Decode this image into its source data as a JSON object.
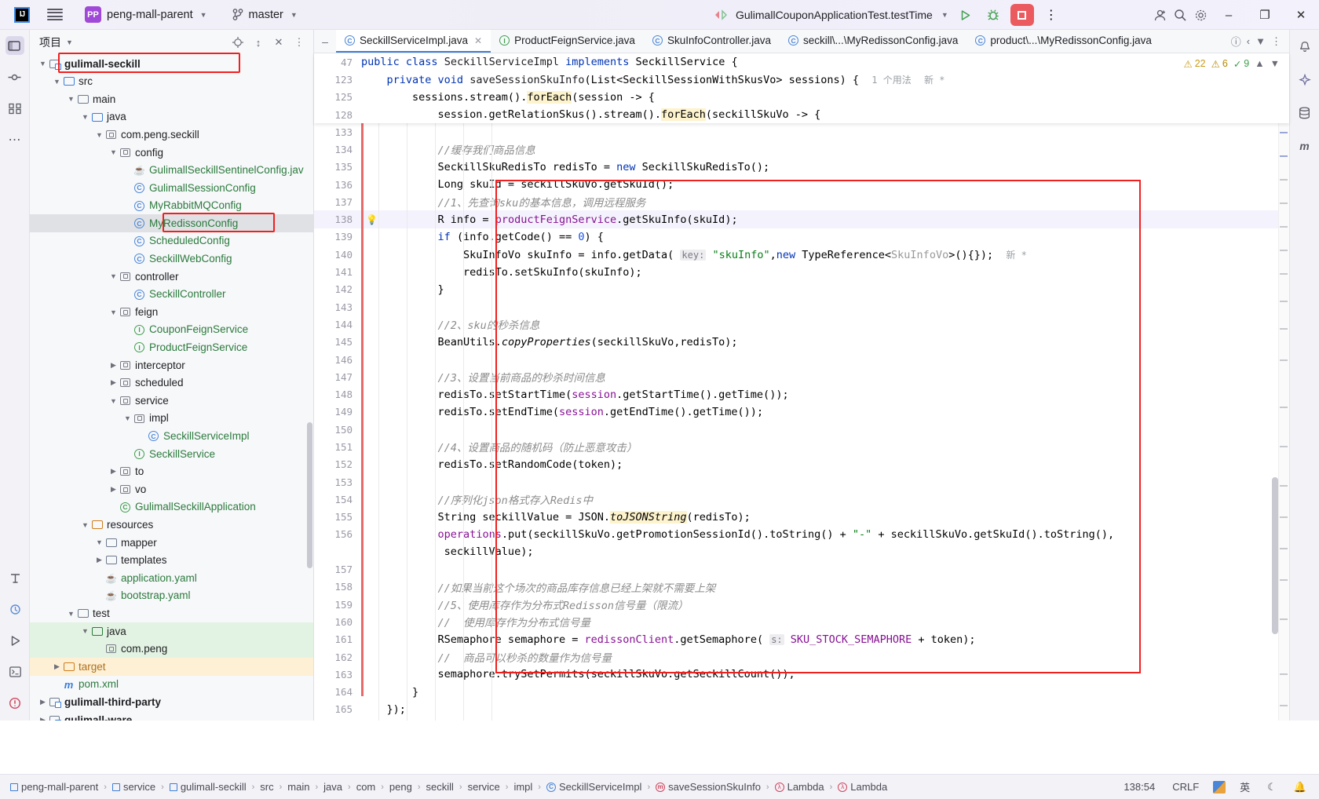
{
  "titlebar": {
    "logo": "IJ",
    "project": "peng-mall-parent",
    "branch": "master",
    "run_config": "GulimallCouponApplicationTest.testTime",
    "icons": {
      "menu": "hamburger-icon",
      "vcs": "git-branch-icon",
      "run": "run-icon",
      "debug": "debug-icon",
      "stop": "stop-icon",
      "more": "more-vertical-icon",
      "account": "account-icon",
      "search": "search-icon",
      "settings": "gear-icon",
      "minimize": "–",
      "maximize": "❐",
      "close": "✕"
    }
  },
  "rail": {
    "top": [
      "project-icon",
      "commit-icon",
      "structure-icon",
      "more-tool-windows-icon"
    ],
    "bottom": [
      "terminal-icon",
      "run-tool-icon",
      "debug-tool-icon",
      "services-icon",
      "problems-icon"
    ]
  },
  "right_rail": [
    "notifications-icon",
    "ai-assistant-icon",
    "database-icon",
    "maven-icon"
  ],
  "project_panel": {
    "title": "项目",
    "actions": [
      "locate-icon",
      "expand-collapse-icon",
      "collapse-all-icon",
      "options-icon"
    ],
    "tree": [
      {
        "depth": 1,
        "arrow": "down",
        "icon": "module",
        "label": "gulimall-seckill",
        "bold": true,
        "color": "dark",
        "boxed": true
      },
      {
        "depth": 2,
        "arrow": "down",
        "icon": "folder-src",
        "label": "src",
        "color": "dark"
      },
      {
        "depth": 3,
        "arrow": "down",
        "icon": "folder",
        "label": "main",
        "color": "dark"
      },
      {
        "depth": 4,
        "arrow": "down",
        "icon": "folder-src",
        "label": "java",
        "color": "dark"
      },
      {
        "depth": 5,
        "arrow": "down",
        "icon": "pkg",
        "label": "com.peng.seckill",
        "color": "dark"
      },
      {
        "depth": 6,
        "arrow": "down",
        "icon": "pkg",
        "label": "config",
        "color": "dark"
      },
      {
        "depth": 7,
        "arrow": "none",
        "icon": "cup",
        "label": "GulimallSeckillSentinelConfig.jav",
        "color": "green"
      },
      {
        "depth": 7,
        "arrow": "none",
        "icon": "class",
        "label": "GulimallSessionConfig",
        "color": "green"
      },
      {
        "depth": 7,
        "arrow": "none",
        "icon": "class",
        "label": "MyRabbitMQConfig",
        "color": "green"
      },
      {
        "depth": 7,
        "arrow": "none",
        "icon": "class",
        "label": "MyRedissonConfig",
        "color": "green",
        "selected": true,
        "boxed2": true
      },
      {
        "depth": 7,
        "arrow": "none",
        "icon": "class",
        "label": "ScheduledConfig",
        "color": "green"
      },
      {
        "depth": 7,
        "arrow": "none",
        "icon": "class",
        "label": "SeckillWebConfig",
        "color": "green"
      },
      {
        "depth": 6,
        "arrow": "down",
        "icon": "pkg",
        "label": "controller",
        "color": "dark"
      },
      {
        "depth": 7,
        "arrow": "none",
        "icon": "class",
        "label": "SeckillController",
        "color": "green"
      },
      {
        "depth": 6,
        "arrow": "down",
        "icon": "pkg",
        "label": "feign",
        "color": "dark"
      },
      {
        "depth": 7,
        "arrow": "none",
        "icon": "iface",
        "label": "CouponFeignService",
        "color": "green"
      },
      {
        "depth": 7,
        "arrow": "none",
        "icon": "iface",
        "label": "ProductFeignService",
        "color": "green"
      },
      {
        "depth": 6,
        "arrow": "right",
        "icon": "pkg",
        "label": "interceptor",
        "color": "dark"
      },
      {
        "depth": 6,
        "arrow": "right",
        "icon": "pkg",
        "label": "scheduled",
        "color": "dark"
      },
      {
        "depth": 6,
        "arrow": "down",
        "icon": "pkg",
        "label": "service",
        "color": "dark"
      },
      {
        "depth": 7,
        "arrow": "down",
        "icon": "pkg",
        "label": "impl",
        "color": "dark"
      },
      {
        "depth": 8,
        "arrow": "none",
        "icon": "class",
        "label": "SeckillServiceImpl",
        "color": "green"
      },
      {
        "depth": 7,
        "arrow": "none",
        "icon": "iface",
        "label": "SeckillService",
        "color": "green"
      },
      {
        "depth": 6,
        "arrow": "right",
        "icon": "pkg",
        "label": "to",
        "color": "dark"
      },
      {
        "depth": 6,
        "arrow": "right",
        "icon": "pkg",
        "label": "vo",
        "color": "dark"
      },
      {
        "depth": 6,
        "arrow": "none",
        "icon": "spring",
        "label": "GulimallSeckillApplication",
        "color": "green"
      },
      {
        "depth": 4,
        "arrow": "down",
        "icon": "folder-res",
        "label": "resources",
        "color": "dark"
      },
      {
        "depth": 5,
        "arrow": "down",
        "icon": "folder",
        "label": "mapper",
        "color": "dark"
      },
      {
        "depth": 5,
        "arrow": "right",
        "icon": "folder",
        "label": "templates",
        "color": "dark"
      },
      {
        "depth": 5,
        "arrow": "none",
        "icon": "yaml",
        "label": "application.yaml",
        "color": "green"
      },
      {
        "depth": 5,
        "arrow": "none",
        "icon": "yaml",
        "label": "bootstrap.yaml",
        "color": "green"
      },
      {
        "depth": 3,
        "arrow": "down",
        "icon": "folder",
        "label": "test",
        "color": "dark"
      },
      {
        "depth": 4,
        "arrow": "down",
        "icon": "folder-test",
        "label": "java",
        "color": "dark",
        "bg": "green"
      },
      {
        "depth": 5,
        "arrow": "none",
        "icon": "pkg",
        "label": "com.peng",
        "color": "dark",
        "bg": "green"
      },
      {
        "depth": 2,
        "arrow": "right",
        "icon": "folder-target",
        "label": "target",
        "color": "orange",
        "bg": "orange"
      },
      {
        "depth": 2,
        "arrow": "none",
        "icon": "maven",
        "label": "pom.xml",
        "color": "green"
      },
      {
        "depth": 1,
        "arrow": "right",
        "icon": "module",
        "label": "gulimall-third-party",
        "bold": true,
        "color": "dark"
      },
      {
        "depth": 1,
        "arrow": "right",
        "icon": "module",
        "label": "gulimall-ware",
        "bold": true,
        "color": "dark"
      }
    ]
  },
  "editor": {
    "tabs": [
      {
        "label": "SeckillServiceImpl.java",
        "icon": "class",
        "active": true,
        "closable": true
      },
      {
        "label": "ProductFeignService.java",
        "icon": "iface",
        "active": false
      },
      {
        "label": "SkuInfoController.java",
        "icon": "class",
        "active": false
      },
      {
        "label": "seckill\\...\\MyRedissonConfig.java",
        "icon": "class",
        "active": false
      },
      {
        "label": "product\\...\\MyRedissonConfig.java",
        "icon": "class",
        "active": false
      }
    ],
    "tab_right_icons": [
      "info-icon",
      "chevron-left-icon",
      "chevron-down-icon",
      "more-vertical-icon"
    ],
    "inspections": {
      "warnings": "22",
      "weak_warnings": "6",
      "typos": "9",
      "ok": "✓"
    },
    "sticky_lines": [
      {
        "num": "47",
        "html": "<span class=\"kw\">public class</span> <span class=\"fn\">SeckillServiceImpl</span> <span class=\"kw\">implements</span> SeckillService {"
      },
      {
        "num": "123",
        "html": "    <span class=\"kw\">private void</span> <span class=\"fn\">saveSessionSkuInfo</span>(List&lt;SeckillSessionWithSkusVo&gt; sessions) {  <span class=\"usage\">1 个用法</span>  <span class=\"usage\">新 *</span>"
      },
      {
        "num": "125",
        "html": "        sessions.stream().<span class=\"hlw\">forEach</span>(session -&gt; {"
      },
      {
        "num": "128",
        "html": "            session.getRelationSkus().stream().<span class=\"hlw\">forEach</span>(seckillSkuVo -&gt; {"
      }
    ],
    "code_lines": [
      {
        "num": "133",
        "html": ""
      },
      {
        "num": "134",
        "html": "            <span class=\"cmt\">//缓存我们商品信息</span>"
      },
      {
        "num": "135",
        "html": "            SeckillSkuRedisTo redisTo = <span class=\"kw\">new</span> SeckillSkuRedisTo();"
      },
      {
        "num": "136",
        "html": "            Long skuId = seckillSkuVo.getSkuId();"
      },
      {
        "num": "137",
        "html": "            <span class=\"cmt\">//1、先查询sku的基本信息，调用远程服务</span>"
      },
      {
        "num": "138",
        "html": "            R info = <span class=\"fld\">productFeignService</span>.<span class=\"hlp\">getSkuInfo</span>(skuId);",
        "bulb": true,
        "highlight": true
      },
      {
        "num": "139",
        "html": "            <span class=\"kw\">if</span> (info.getCode() == <span class=\"num\">0</span>) {"
      },
      {
        "num": "140",
        "html": "                SkuInfoVo skuInfo = info.getData( <span class=\"hint\">key:</span> <span class=\"str\">\"skuInfo\"</span>,<span class=\"kw\">new</span> TypeReference&lt;<span class=\"gray\">SkuInfoVo</span>&gt;(){});  <span class=\"usage\">新 *</span>"
      },
      {
        "num": "141",
        "html": "                redisTo.setSkuInfo(skuInfo);"
      },
      {
        "num": "142",
        "html": "            }"
      },
      {
        "num": "143",
        "html": ""
      },
      {
        "num": "144",
        "html": "            <span class=\"cmt\">//2、sku的秒杀信息</span>"
      },
      {
        "num": "145",
        "html": "            BeanUtils.<span class=\"ital\">copyProperties</span>(seckillSkuVo,redisTo);"
      },
      {
        "num": "146",
        "html": ""
      },
      {
        "num": "147",
        "html": "            <span class=\"cmt\">//3、设置当前商品的秒杀时间信息</span>"
      },
      {
        "num": "148",
        "html": "            redisTo.setStartTime(<span class=\"fld\">session</span>.getStartTime().getTime());"
      },
      {
        "num": "149",
        "html": "            redisTo.setEndTime(<span class=\"fld\">session</span>.getEndTime().getTime());"
      },
      {
        "num": "150",
        "html": ""
      },
      {
        "num": "151",
        "html": "            <span class=\"cmt\">//4、设置商品的随机码（防止恶意攻击）</span>"
      },
      {
        "num": "152",
        "html": "            redisTo.setRandomCode(token);"
      },
      {
        "num": "153",
        "html": ""
      },
      {
        "num": "154",
        "html": "            <span class=\"cmt\">//序列化json格式存入Redis中</span>"
      },
      {
        "num": "155",
        "html": "            String seckillValue = JSON.<span class=\"hlw ital\">toJSONString</span>(redisTo);"
      },
      {
        "num": "156",
        "html": "            <span class=\"fld\">operations</span>.put(seckillSkuVo.getPromotionSessionId().toString() + <span class=\"str\">\"-\"</span> + seckillSkuVo.getSkuId().toString(),"
      },
      {
        "num": "",
        "html": "             seckillValue);"
      },
      {
        "num": "157",
        "html": ""
      },
      {
        "num": "158",
        "html": "            <span class=\"cmt\">//如果当前这个场次的商品库存信息已经上架就不需要上架</span>"
      },
      {
        "num": "159",
        "html": "            <span class=\"cmt\">//5、使用库存作为分布式Redisson信号量（限流）</span>"
      },
      {
        "num": "160",
        "html": "            <span class=\"cmt\">//  使用库存作为分布式信号量</span>"
      },
      {
        "num": "161",
        "html": "            RSemaphore semaphore = <span class=\"fld\">redissonClient</span>.getSemaphore( <span class=\"hint\">s:</span> <span class=\"fld\">SKU_STOCK_SEMAPHORE</span> + token);"
      },
      {
        "num": "162",
        "html": "            <span class=\"cmt\">//  商品可以秒杀的数量作为信号量</span>"
      },
      {
        "num": "163",
        "html": "            semaphore.trySetPermits(seckillSkuVo.getSeckillCount());"
      },
      {
        "num": "164",
        "html": "        }"
      },
      {
        "num": "165",
        "html": "    });"
      }
    ]
  },
  "status_bar": {
    "breadcrumbs": [
      {
        "icon": "module",
        "label": "peng-mall-parent"
      },
      {
        "icon": "module",
        "label": "service"
      },
      {
        "icon": "module",
        "label": "gulimall-seckill"
      },
      {
        "icon": "none",
        "label": "src"
      },
      {
        "icon": "none",
        "label": "main"
      },
      {
        "icon": "none",
        "label": "java"
      },
      {
        "icon": "none",
        "label": "com"
      },
      {
        "icon": "none",
        "label": "peng"
      },
      {
        "icon": "none",
        "label": "seckill"
      },
      {
        "icon": "none",
        "label": "service"
      },
      {
        "icon": "none",
        "label": "impl"
      },
      {
        "icon": "class",
        "label": "SeckillServiceImpl"
      },
      {
        "icon": "method",
        "label": "saveSessionSkuInfo"
      },
      {
        "icon": "lambda",
        "label": "Lambda"
      },
      {
        "icon": "lambda",
        "label": "Lambda"
      }
    ],
    "caret_position": "138:54",
    "line_separator": "CRLF",
    "ime": "英"
  },
  "colors": {
    "accent": "#3b7dd8",
    "annotation_red": "#f02020",
    "green_text": "#2b7a3d",
    "keyword_blue": "#0033b3",
    "string_green": "#067d17",
    "field_purple": "#871094",
    "stop_red": "#eb5a5f",
    "badge_purple": "#a048d8"
  }
}
